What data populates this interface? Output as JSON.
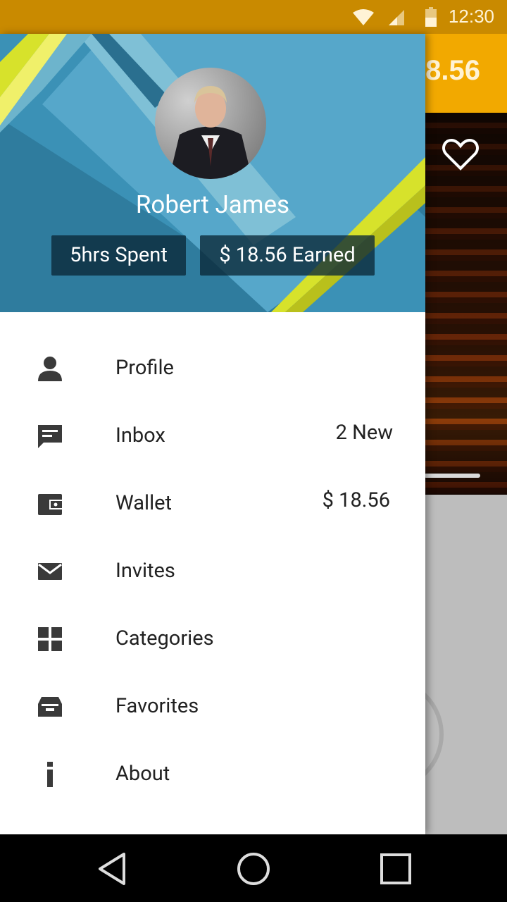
{
  "status_bar": {
    "time": "12:30",
    "icons": [
      "wifi-icon",
      "signal-icon",
      "battery-icon"
    ]
  },
  "background_app": {
    "amount_text": "8.56",
    "icons": [
      "heart-icon"
    ]
  },
  "drawer": {
    "user": {
      "name": "Robert James",
      "hours_spent": "5hrs Spent",
      "earned": "$ 18.56 Earned"
    },
    "items": [
      {
        "label": "Profile",
        "icon": "person-icon",
        "meta": ""
      },
      {
        "label": "Inbox",
        "icon": "message-icon",
        "meta": "2 New"
      },
      {
        "label": "Wallet",
        "icon": "wallet-icon",
        "meta": "$ 18.56"
      },
      {
        "label": "Invites",
        "icon": "mail-icon",
        "meta": ""
      },
      {
        "label": "Categories",
        "icon": "grid-icon",
        "meta": ""
      },
      {
        "label": "Favorites",
        "icon": "tray-icon",
        "meta": ""
      },
      {
        "label": "About",
        "icon": "info-icon",
        "meta": ""
      }
    ]
  },
  "nav_bar": {
    "buttons": [
      "back-icon",
      "home-icon",
      "recents-icon"
    ]
  },
  "colors": {
    "status_bar": "#c98a00",
    "toolbar": "#f2a900",
    "header_blue": "#2f7c9e",
    "accent_yellow": "#d7e22b",
    "chip_bg": "#0a2837"
  }
}
